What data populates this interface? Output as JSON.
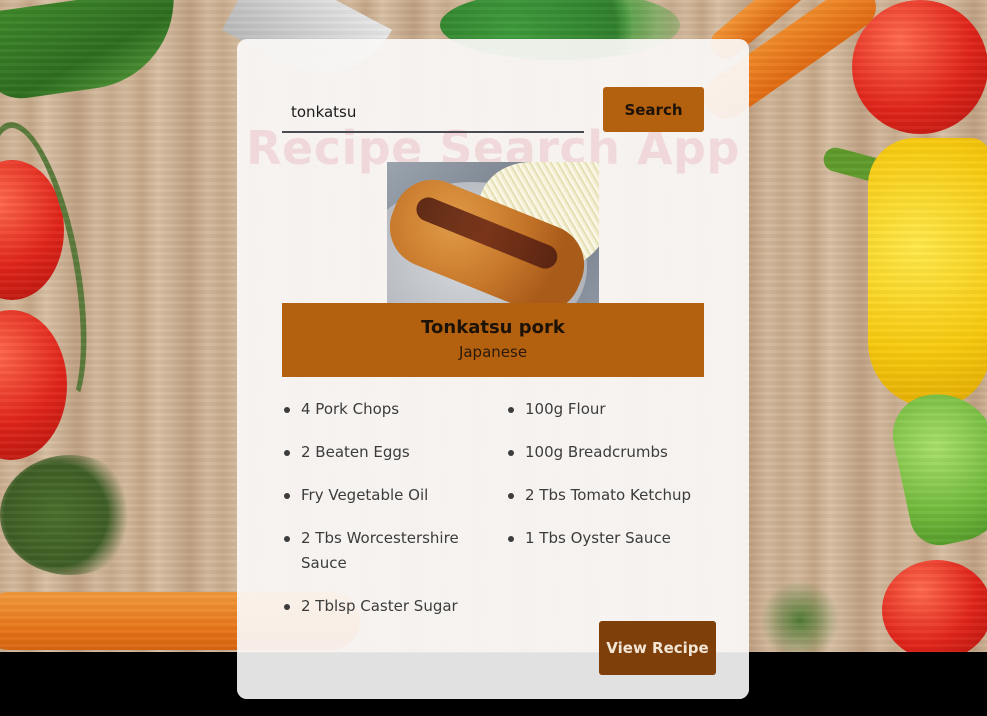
{
  "app": {
    "watermark_title": "Recipe Search App"
  },
  "search": {
    "value": "tonkatsu",
    "button_label": "Search"
  },
  "recipe": {
    "name": "Tonkatsu pork",
    "cuisine": "Japanese",
    "ingredients": [
      "4 Pork Chops",
      "100g Flour",
      "2 Beaten Eggs",
      "100g Breadcrumbs",
      "Fry Vegetable Oil",
      "2 Tbs Tomato Ketchup",
      "2 Tbs Worcestershire Sauce",
      "1 Tbs Oyster Sauce",
      "2 Tblsp Caster Sugar"
    ],
    "view_button_label": "View Recipe"
  },
  "colors": {
    "accent": "#b3600f",
    "accent_dark": "#7e3f0b",
    "card_background": "#faf8f6"
  }
}
